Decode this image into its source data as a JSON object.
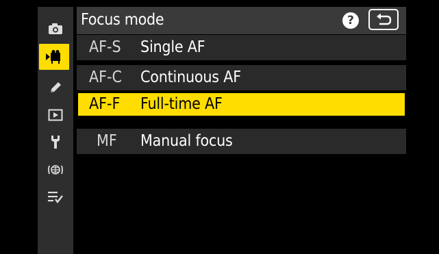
{
  "header": {
    "title": "Focus mode"
  },
  "sidebar": {
    "items": [
      {
        "icon": "camera-icon"
      },
      {
        "icon": "movie-icon",
        "active": true
      },
      {
        "icon": "pencil-icon"
      },
      {
        "icon": "playback-icon"
      },
      {
        "icon": "wrench-icon"
      },
      {
        "icon": "network-icon"
      },
      {
        "icon": "my-menu-icon"
      }
    ]
  },
  "menu": {
    "items": [
      {
        "code": "AF-S",
        "label": "Single AF"
      },
      {
        "code": "AF-C",
        "label": "Continuous AF"
      },
      {
        "code": "AF-F",
        "label": "Full-time AF",
        "selected": true
      },
      {
        "code": "MF",
        "label": "Manual focus"
      }
    ]
  },
  "colors": {
    "highlight": "#ffdd00",
    "sidebar": "#2e2e2e",
    "header": "#3a3a3a",
    "row": "#2a2a2a",
    "background": "#000000"
  }
}
